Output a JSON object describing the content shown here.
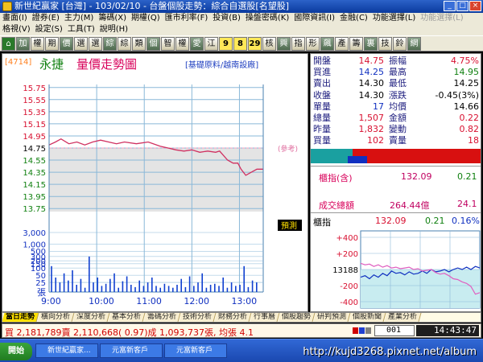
{
  "window": {
    "title": "新世紀贏家 [台灣] - 103/02/10 - 台盤個股走勢：綜合自選股[名望股]"
  },
  "menu": {
    "row1": [
      {
        "label": "畫面(I)",
        "enabled": true
      },
      {
        "label": "證券(E)",
        "enabled": true
      },
      {
        "label": "主力(M)",
        "enabled": true
      },
      {
        "label": "籌碼(X)",
        "enabled": true
      },
      {
        "label": "期權(Q)",
        "enabled": true
      },
      {
        "label": "匯市利率(F)",
        "enabled": true
      },
      {
        "label": "投資(B)",
        "enabled": true
      },
      {
        "label": "操盤密碼(K)",
        "enabled": true
      },
      {
        "label": "國際資訊(I)",
        "enabled": true
      },
      {
        "label": "金融(C)",
        "enabled": true
      },
      {
        "label": "功能選擇(L)",
        "enabled": true
      },
      {
        "label": "功能選擇(L)",
        "enabled": false
      }
    ],
    "row2": [
      {
        "label": "格視(V)",
        "enabled": true
      },
      {
        "label": "設定(S)",
        "enabled": true
      },
      {
        "label": "工具(T)",
        "enabled": true
      },
      {
        "label": "說明(H)",
        "enabled": true
      }
    ]
  },
  "toolbar": [
    {
      "label": "⌂",
      "style": "home"
    },
    {
      "label": "加",
      "style": ""
    },
    {
      "label": "權",
      "style": ""
    },
    {
      "label": "期",
      "style": ""
    },
    {
      "label": "價",
      "style": ""
    },
    {
      "label": "選",
      "style": ""
    },
    {
      "label": "選",
      "style": ""
    },
    {
      "label": "綜",
      "style": ""
    },
    {
      "label": "綜",
      "style": ""
    },
    {
      "label": "類",
      "style": ""
    },
    {
      "label": "個",
      "style": ""
    },
    {
      "label": "智",
      "style": ""
    },
    {
      "label": "權",
      "style": ""
    },
    {
      "label": "愛",
      "style": ""
    },
    {
      "label": "江",
      "style": ""
    },
    {
      "label": "9",
      "style": "yel"
    },
    {
      "label": "8",
      "style": "yel"
    },
    {
      "label": "29",
      "style": "yel"
    },
    {
      "label": "核",
      "style": ""
    },
    {
      "label": "興",
      "style": ""
    },
    {
      "label": "指",
      "style": ""
    },
    {
      "label": "形",
      "style": ""
    },
    {
      "label": "飆",
      "style": ""
    },
    {
      "label": "產",
      "style": ""
    },
    {
      "label": "籌",
      "style": ""
    },
    {
      "label": "裏",
      "style": ""
    },
    {
      "label": "技",
      "style": ""
    },
    {
      "label": "鈴",
      "style": ""
    },
    {
      "label": "網",
      "style": ""
    }
  ],
  "stock": {
    "code": "[4714]",
    "name": "永捷",
    "chart_title": "量價走勢圖",
    "links": "[基礎原料/越南設廠]"
  },
  "quote": {
    "rows": [
      {
        "l1": "開盤",
        "v1": "14.75",
        "v1c": "red",
        "l2": "振幅",
        "v2": "4.75%",
        "v2c": "red"
      },
      {
        "l1": "買進",
        "v1": "14.25",
        "v1c": "",
        "l2": "最高",
        "v2": "14.95",
        "v2c": "grn"
      },
      {
        "l1": "賣出",
        "v1": "14.30",
        "v1c": "blk",
        "l2": "最低",
        "v2": "14.25",
        "v2c": "blk"
      },
      {
        "l1": "收盤",
        "v1": "14.30",
        "v1c": "blk",
        "l2": "漲跌",
        "v2": "-0.45(3%)",
        "v2c": "blk"
      },
      {
        "l1": "單量",
        "v1": "17",
        "v1c": "",
        "l2": "均價",
        "v2": "14.66",
        "v2c": "blk"
      },
      {
        "l1": "總量",
        "v1": "1,507",
        "v1c": "red",
        "l2": "金額",
        "v2": "0.22",
        "v2c": "red"
      },
      {
        "l1": "昨量",
        "v1": "1,832",
        "v1c": "red",
        "l2": "變動",
        "v2": "0.82",
        "v2c": "red"
      },
      {
        "l1": "買量",
        "v1": "102",
        "v1c": "red",
        "l2": "賣量",
        "v2": "18",
        "v2c": "red"
      }
    ]
  },
  "market": {
    "index_label": "櫃指(含)",
    "index_value": "132.09",
    "index_change": "0.21",
    "turnover_label": "成交總額",
    "turnover_value": "264.44億",
    "turnover_extra": "24.1"
  },
  "mini": {
    "label": "櫃指",
    "value": "132.09",
    "change": "0.21",
    "pct": "0.16%",
    "y_ticks": [
      "+400",
      "+200",
      "13188",
      "-200",
      "-400"
    ],
    "price_line": [
      0.6,
      0.58,
      0.62,
      0.57,
      0.6,
      0.55,
      0.58,
      0.52,
      0.55,
      0.54,
      0.57,
      0.53,
      0.56,
      0.55,
      0.52,
      0.55,
      0.5,
      0.53,
      0.52,
      0.5,
      0.53,
      0.5,
      0.48,
      0.5,
      0.47,
      0.5,
      0.46,
      0.48
    ],
    "volume_line": [
      0.42,
      0.44,
      0.43,
      0.46,
      0.44,
      0.47,
      0.45,
      0.48,
      0.47,
      0.49,
      0.48,
      0.47,
      0.5,
      0.49,
      0.52,
      0.51,
      0.5,
      0.54,
      0.56,
      0.55,
      0.58,
      0.62,
      0.63,
      0.66,
      0.68,
      0.72,
      0.82,
      0.8
    ]
  },
  "chart_data": {
    "type": "line",
    "title": "量價走勢圖",
    "x_ticks": [
      "9:00",
      "10:00",
      "11:00",
      "12:00",
      "13:00"
    ],
    "x_range": [
      0,
      270
    ],
    "price_ylim": [
      13.7,
      15.8
    ],
    "price_ticks": [
      "15.75",
      "15.55",
      "15.35",
      "15.15",
      "14.95",
      "14.75",
      "14.55",
      "14.35",
      "14.15",
      "13.95",
      "13.75"
    ],
    "price_tick_values": [
      15.75,
      15.55,
      15.35,
      15.15,
      14.95,
      14.75,
      14.55,
      14.35,
      14.15,
      13.95,
      13.75
    ],
    "reference": 14.75,
    "reference_label": "(參考)",
    "prediction_label": "預測",
    "series": [
      {
        "x": [
          0,
          8,
          15,
          25,
          35,
          45,
          55,
          65,
          75,
          85,
          95,
          110,
          125,
          140,
          150,
          160,
          170,
          180,
          190,
          200,
          210,
          215,
          225,
          232,
          238,
          242,
          248,
          255,
          262,
          270
        ],
        "values": [
          14.8,
          14.85,
          14.9,
          14.82,
          14.85,
          14.8,
          14.85,
          14.88,
          14.85,
          14.82,
          14.85,
          14.82,
          14.85,
          14.78,
          14.75,
          14.72,
          14.7,
          14.72,
          14.68,
          14.7,
          14.68,
          14.7,
          14.55,
          14.5,
          14.5,
          14.4,
          14.3,
          14.35,
          14.4,
          14.4
        ]
      }
    ],
    "volume_ticks": [
      "3,000",
      "1,000",
      "500",
      "300",
      "200",
      "150",
      "100",
      "50",
      "25"
    ],
    "volume_unit": "張",
    "volume_bars": [
      120,
      40,
      25,
      60,
      30,
      80,
      20,
      35,
      15,
      300,
      25,
      40,
      18,
      22,
      35,
      60,
      15,
      28,
      45,
      20,
      16,
      30,
      18,
      25,
      40,
      18,
      15,
      22,
      18,
      15,
      20,
      35,
      16,
      45,
      18,
      25,
      60,
      15,
      20,
      22,
      18,
      40,
      15,
      25,
      18,
      20,
      120,
      16,
      30,
      25
    ]
  },
  "tabs": [
    {
      "label": "當日走勢",
      "active": true
    },
    {
      "label": "橫向分析",
      "active": false
    },
    {
      "label": "深度分析",
      "active": false
    },
    {
      "label": "基本分析",
      "active": false
    },
    {
      "label": "籌碼分析",
      "active": false
    },
    {
      "label": "技術分析",
      "active": false
    },
    {
      "label": "財務分析",
      "active": false
    },
    {
      "label": "行事曆",
      "active": false
    },
    {
      "label": "個股趨勢",
      "active": false
    },
    {
      "label": "研判預測",
      "active": false
    },
    {
      "label": "個股新聞",
      "active": false
    },
    {
      "label": "產業分析",
      "active": false
    }
  ],
  "status": {
    "text": "買 2,181,789賣 2,110,668( 0.97)成 1,093,737張, 均張 4.1",
    "page": "001",
    "time": "14:43:47"
  },
  "taskbar": {
    "start": "開始",
    "tasks": [
      "新世紀贏家...",
      "元富新客戶",
      "元富新客戶"
    ],
    "url": "http://kujd3268.pixnet.net/album"
  },
  "colors": {
    "up": "#d81030",
    "down": "#108010",
    "price_line": "#d03060",
    "volume_bar": "#1040d0",
    "grid": "#8ab8d8"
  }
}
